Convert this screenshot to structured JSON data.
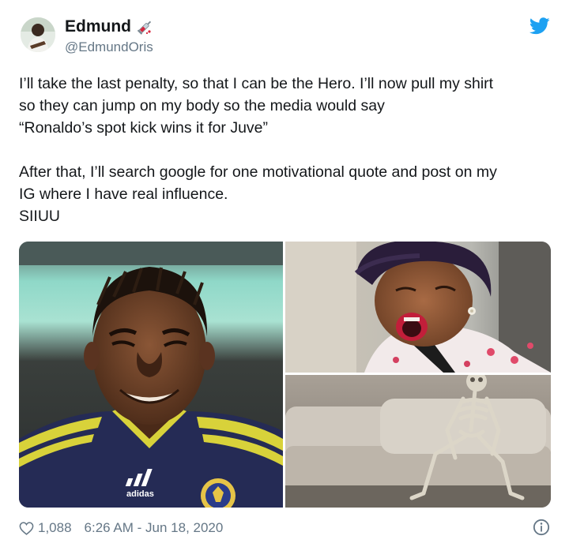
{
  "author": {
    "display_name": "Edmund",
    "handle": "@EdmundOris"
  },
  "tweet": {
    "lines": [
      "I’ll take the last penalty, so that I can be the Hero. I’ll now pull my shirt",
      "so they can jump on my body so the media would say",
      "“Ronaldo’s spot kick wins it for Juve”",
      "After that, I’ll search google for one motivational quote and post on my",
      "IG where I have real influence.",
      "SIIUU"
    ]
  },
  "media": {
    "images": [
      {
        "name": "smiling-footballer-photo"
      },
      {
        "name": "woman-exclaiming-photo"
      },
      {
        "name": "skeleton-on-couch-photo"
      }
    ],
    "logo_text": "adidas"
  },
  "footer": {
    "likes": "1,088",
    "timestamp": "6:26 AM - Jun 18, 2020"
  },
  "icons": {
    "twitter": "twitter-bird-icon",
    "like": "heart-icon",
    "info": "info-icon",
    "name_emoji": "syringe-emoji-icon"
  },
  "colors": {
    "twitter_blue": "#1da1f2",
    "secondary_text": "#657786",
    "primary_text": "#14171a"
  }
}
